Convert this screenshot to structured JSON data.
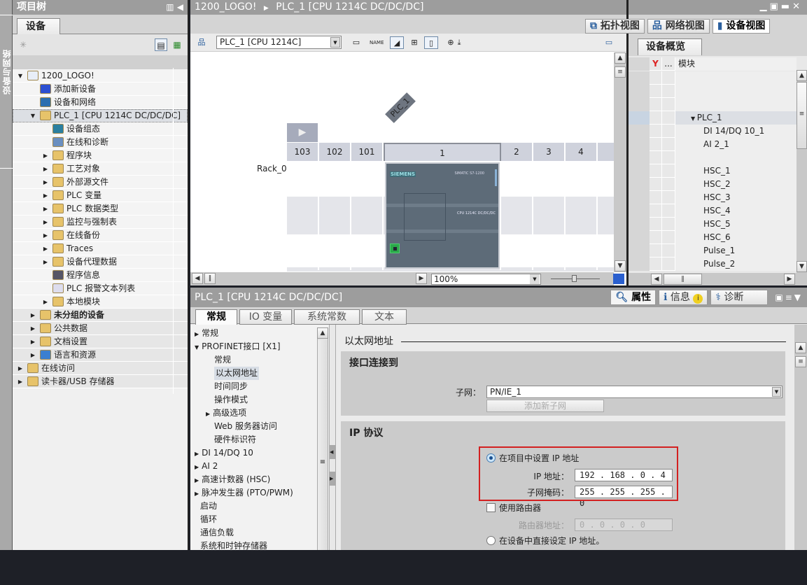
{
  "side_strip": {
    "label": "设备与网络"
  },
  "project_tree": {
    "title": "项目树",
    "tab": "设备",
    "items": [
      {
        "label": "1200_LOGO!",
        "level": 0,
        "expand": "open",
        "icon": "project-icon"
      },
      {
        "label": "添加新设备",
        "level": 1,
        "expand": "none",
        "icon": "add-device-icon"
      },
      {
        "label": "设备和网络",
        "level": 1,
        "expand": "none",
        "icon": "network-icon"
      },
      {
        "label": "PLC_1 [CPU 1214C DC/DC/DC]",
        "level": 1,
        "expand": "open",
        "icon": "plc-folder-icon",
        "selected": true
      },
      {
        "label": "设备组态",
        "level": 2,
        "expand": "none",
        "icon": "device-config-icon"
      },
      {
        "label": "在线和诊断",
        "level": 2,
        "expand": "none",
        "icon": "diagnostics-icon"
      },
      {
        "label": "程序块",
        "level": 2,
        "expand": "closed",
        "icon": "program-blocks-folder-icon"
      },
      {
        "label": "工艺对象",
        "level": 2,
        "expand": "closed",
        "icon": "technology-objects-folder-icon"
      },
      {
        "label": "外部源文件",
        "level": 2,
        "expand": "closed",
        "icon": "external-source-folder-icon"
      },
      {
        "label": "PLC 变量",
        "level": 2,
        "expand": "closed",
        "icon": "plc-tags-folder-icon"
      },
      {
        "label": "PLC 数据类型",
        "level": 2,
        "expand": "closed",
        "icon": "plc-datatypes-folder-icon"
      },
      {
        "label": "监控与强制表",
        "level": 2,
        "expand": "closed",
        "icon": "watch-tables-folder-icon"
      },
      {
        "label": "在线备份",
        "level": 2,
        "expand": "closed",
        "icon": "online-backup-folder-icon"
      },
      {
        "label": "Traces",
        "level": 2,
        "expand": "closed",
        "icon": "traces-folder-icon"
      },
      {
        "label": "设备代理数据",
        "level": 2,
        "expand": "closed",
        "icon": "device-proxy-folder-icon"
      },
      {
        "label": "程序信息",
        "level": 2,
        "expand": "none",
        "icon": "program-info-icon"
      },
      {
        "label": "PLC 报警文本列表",
        "level": 2,
        "expand": "none",
        "icon": "alarm-text-icon"
      },
      {
        "label": "本地模块",
        "level": 2,
        "expand": "closed",
        "icon": "local-modules-folder-icon"
      },
      {
        "label": "未分组的设备",
        "level": 1,
        "expand": "closed",
        "icon": "ungrouped-devices-icon",
        "bold": true
      },
      {
        "label": "公共数据",
        "level": 1,
        "expand": "closed",
        "icon": "common-data-icon"
      },
      {
        "label": "文档设置",
        "level": 1,
        "expand": "closed",
        "icon": "document-settings-icon"
      },
      {
        "label": "语言和资源",
        "level": 1,
        "expand": "closed",
        "icon": "languages-resources-icon"
      },
      {
        "label": "在线访问",
        "level": 0,
        "expand": "closed",
        "icon": "online-access-icon"
      },
      {
        "label": "读卡器/USB 存储器",
        "level": 0,
        "expand": "closed",
        "icon": "card-reader-icon"
      }
    ]
  },
  "editor": {
    "breadcrumb": [
      "1200_LOGO!",
      "PLC_1 [CPU 1214C DC/DC/DC]"
    ],
    "device_select": "PLC_1 [CPU 1214C]",
    "view_tabs": [
      "拓扑视图",
      "网络视图",
      "设备视图"
    ],
    "active_view": "设备视图",
    "device_label": "PLC_1",
    "rack_label": "Rack_0",
    "slots": [
      "103",
      "102",
      "101",
      "1",
      "2",
      "3",
      "4"
    ],
    "cpu": {
      "brand": "SIEMENS",
      "family": "SIMATIC S7-1200",
      "model": "CPU 1214C DC/DC/DC"
    },
    "zoom": "100%"
  },
  "overview": {
    "tab": "设备概览",
    "column_module": "模块",
    "column_dots": "...",
    "rows": [
      "",
      "",
      "",
      "PLC_1",
      "DI 14/DQ 10_1",
      "AI 2_1",
      "",
      "HSC_1",
      "HSC_2",
      "HSC_3",
      "HSC_4",
      "HSC_5",
      "HSC_6",
      "Pulse_1",
      "Pulse_2"
    ]
  },
  "inspector": {
    "title": "PLC_1 [CPU 1214C DC/DC/DC]",
    "right_tabs": [
      "属性",
      "信息",
      "诊断"
    ],
    "tabs": [
      "常规",
      "IO 变量",
      "系统常数",
      "文本"
    ],
    "nav": [
      {
        "label": "常规",
        "level": 0,
        "expand": "closed"
      },
      {
        "label": "PROFINET接口 [X1]",
        "level": 0,
        "expand": "open"
      },
      {
        "label": "常规",
        "level": 1,
        "expand": "none"
      },
      {
        "label": "以太网地址",
        "level": 1,
        "expand": "none",
        "selected": true
      },
      {
        "label": "时间同步",
        "level": 1,
        "expand": "none"
      },
      {
        "label": "操作模式",
        "level": 1,
        "expand": "none"
      },
      {
        "label": "高级选项",
        "level": 1,
        "expand": "closed"
      },
      {
        "label": "Web 服务器访问",
        "level": 1,
        "expand": "none"
      },
      {
        "label": "硬件标识符",
        "level": 1,
        "expand": "none"
      },
      {
        "label": "DI 14/DQ 10",
        "level": 0,
        "expand": "closed"
      },
      {
        "label": "AI 2",
        "level": 0,
        "expand": "closed"
      },
      {
        "label": "高速计数器 (HSC)",
        "level": 0,
        "expand": "closed"
      },
      {
        "label": "脉冲发生器 (PTO/PWM)",
        "level": 0,
        "expand": "closed"
      },
      {
        "label": "启动",
        "level": 0,
        "expand": "none"
      },
      {
        "label": "循环",
        "level": 0,
        "expand": "none"
      },
      {
        "label": "通信负载",
        "level": 0,
        "expand": "none"
      },
      {
        "label": "系统和时钟存储器",
        "level": 0,
        "expand": "none"
      }
    ],
    "section_title": "以太网地址",
    "interface": {
      "title": "接口连接到",
      "subnet_label": "子网：",
      "subnet_value": "PN/IE_1",
      "add_subnet_button": "添加新子网"
    },
    "ip": {
      "title": "IP 协议",
      "set_in_project": "在项目中设置 IP 地址",
      "ip_label": "IP 地址：",
      "ip_value": "192 . 168 . 0   . 4",
      "mask_label": "子网掩码：",
      "mask_value": "255 . 255 . 255 . 0",
      "use_router": "使用路由器",
      "router_label": "路由器地址：",
      "router_value": "0   . 0   . 0   . 0",
      "set_on_device": "在设备中直接设定 IP 地址。",
      "selected_option": "set_in_project",
      "use_router_checked": false
    }
  },
  "colors": {
    "highlight_box": "#d32020",
    "title_bar": "#9d9d9d"
  }
}
